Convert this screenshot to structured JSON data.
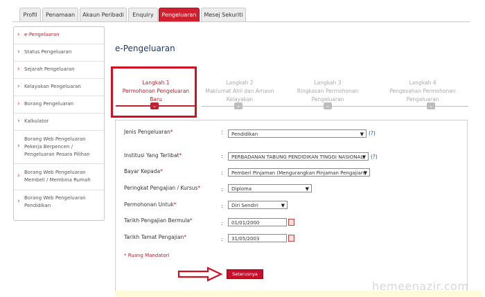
{
  "tabs": [
    "Profil",
    "Penamaan",
    "Akaun Peribadi",
    "Enquiry",
    "Pengeluaran",
    "Mesej Sekuriti"
  ],
  "sidebar": [
    "e-Pengeluaran",
    "Status Pengeluaran",
    "Sejarah Pengeluaran",
    "Kelayakan Pengeluaran",
    "Borang Pengeluaran",
    "Kalkulator",
    "Borang Web Pengeluaran Pekerja Berpencen / Pengeluaran Pesara Pilihan",
    "Borang Web Pengeluaran Membeli / Membina Rumah",
    "Borang Web Pengeluaran Pendidikan"
  ],
  "title": "e-Pengeluaran",
  "steps": [
    {
      "l1": "Langkah 1",
      "l2": "Permohonan Pengeluaran",
      "l3": "Baru"
    },
    {
      "l1": "Langkah 2",
      "l2": "Maklumat Ahli dan Amaun",
      "l3": "Kelayakan"
    },
    {
      "l1": "Langkah 3",
      "l2": "Ringkasan Permohonan",
      "l3": "Pengeluaran"
    },
    {
      "l1": "Langkah 4",
      "l2": "Pengesahan Permohonan",
      "l3": "Pengeluaran"
    }
  ],
  "form": {
    "jenis_label": "Jenis Pengeluaran",
    "jenis_value": "Pendidikan",
    "institusi_label": "Institusi Yang Terlibat",
    "institusi_value": "PERBADANAN TABUNG PENDIDIKAN TINGGI NASIONAL",
    "bayar_label": "Bayar Kepada",
    "bayar_value": "Pemberi Pinjaman (Mengurangkan Pinjaman Pengajian)",
    "peringkat_label": "Peringkat Pengajian / Kursus",
    "peringkat_value": "Diploma",
    "permohonan_label": "Permohonan Untuk",
    "permohonan_value": "Diri Sendiri",
    "mula_label": "Tarikh Pengajian Bermula",
    "mula_value": "01/01/2000",
    "tamat_label": "Tarikh Tamat Pengajian",
    "tamat_value": "31/05/2003",
    "colon": ":",
    "star": "*",
    "help": "(?)"
  },
  "mandatory_note": "* Ruang Mandatori",
  "submit_label": "Seterusnya",
  "watermark": "hemeenazir.com"
}
